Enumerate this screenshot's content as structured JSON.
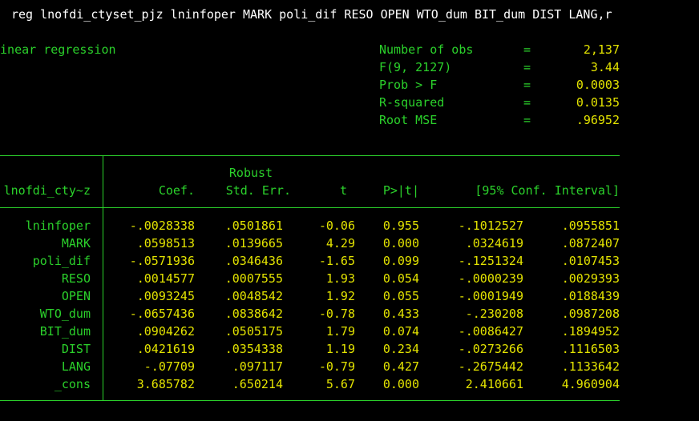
{
  "command": "reg lnofdi_ctyset_pjz lninfoper MARK poli_dif RESO OPEN WTO_dum BIT_dum DIST LANG,r",
  "regression_title": "Linear regression",
  "stats": [
    {
      "label": "Number of obs",
      "eq": "=",
      "value": "2,137"
    },
    {
      "label": "F(9, 2127)",
      "eq": "=",
      "value": "3.44"
    },
    {
      "label": "Prob > F",
      "eq": "=",
      "value": "0.0003"
    },
    {
      "label": "R-squared",
      "eq": "=",
      "value": "0.0135"
    },
    {
      "label": "Root MSE",
      "eq": "=",
      "value": ".96952"
    }
  ],
  "table": {
    "depvar": "lnofdi_cty~z",
    "header_top": "Robust",
    "headers": [
      "Coef.",
      "Std. Err.",
      "t",
      "P>|t|",
      "[95% Conf. Interval]"
    ],
    "rows": [
      {
        "name": "lninfoper",
        "coef": "-.0028338",
        "se": ".0501861",
        "t": "-0.06",
        "p": "0.955",
        "lo": "-.1012527",
        "hi": ".0955851"
      },
      {
        "name": "MARK",
        "coef": ".0598513",
        "se": ".0139665",
        "t": "4.29",
        "p": "0.000",
        "lo": ".0324619",
        "hi": ".0872407"
      },
      {
        "name": "poli_dif",
        "coef": "-.0571936",
        "se": ".0346436",
        "t": "-1.65",
        "p": "0.099",
        "lo": "-.1251324",
        "hi": ".0107453"
      },
      {
        "name": "RESO",
        "coef": ".0014577",
        "se": ".0007555",
        "t": "1.93",
        "p": "0.054",
        "lo": "-.0000239",
        "hi": ".0029393"
      },
      {
        "name": "OPEN",
        "coef": ".0093245",
        "se": ".0048542",
        "t": "1.92",
        "p": "0.055",
        "lo": "-.0001949",
        "hi": ".0188439"
      },
      {
        "name": "WTO_dum",
        "coef": "-.0657436",
        "se": ".0838642",
        "t": "-0.78",
        "p": "0.433",
        "lo": "-.230208",
        "hi": ".0987208"
      },
      {
        "name": "BIT_dum",
        "coef": ".0904262",
        "se": ".0505175",
        "t": "1.79",
        "p": "0.074",
        "lo": "-.0086427",
        "hi": ".1894952"
      },
      {
        "name": "DIST",
        "coef": ".0421619",
        "se": ".0354338",
        "t": "1.19",
        "p": "0.234",
        "lo": "-.0273266",
        "hi": ".1116503"
      },
      {
        "name": "LANG",
        "coef": "-.07709",
        "se": ".097117",
        "t": "-0.79",
        "p": "0.427",
        "lo": "-.2675442",
        "hi": ".1133642"
      },
      {
        "name": "_cons",
        "coef": "3.685782",
        "se": ".650214",
        "t": "5.67",
        "p": "0.000",
        "lo": "2.410661",
        "hi": "4.960904"
      }
    ]
  }
}
